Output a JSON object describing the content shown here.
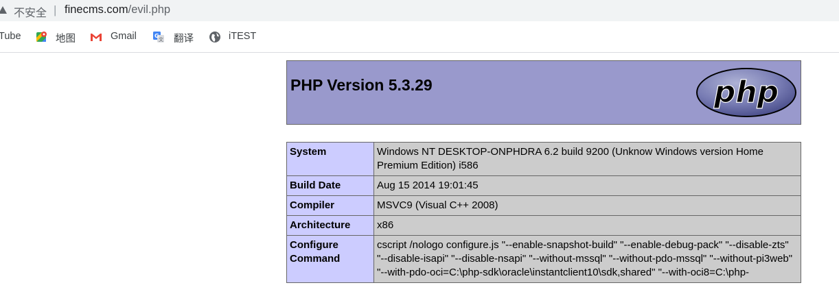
{
  "browser": {
    "security_label": "不安全",
    "separator": "|",
    "url_host": "finecms.com",
    "url_path": "/evil.php"
  },
  "bookmarks": [
    {
      "label": "Tube",
      "icon": "youtube-icon"
    },
    {
      "label": "地图",
      "icon": "maps-icon"
    },
    {
      "label": "Gmail",
      "icon": "gmail-icon"
    },
    {
      "label": "翻译",
      "icon": "translate-icon"
    },
    {
      "label": "iTEST",
      "icon": "globe-icon"
    }
  ],
  "phpinfo": {
    "title": "PHP Version 5.3.29",
    "logo_text": "php",
    "rows": [
      {
        "key": "System",
        "value": "Windows NT DESKTOP-ONPHDRA 6.2 build 9200 (Unknow Windows version Home Premium Edition) i586"
      },
      {
        "key": "Build Date",
        "value": "Aug 15 2014 19:01:45"
      },
      {
        "key": "Compiler",
        "value": "MSVC9 (Visual C++ 2008)"
      },
      {
        "key": "Architecture",
        "value": "x86"
      },
      {
        "key": "Configure Command",
        "value": "cscript /nologo configure.js \"--enable-snapshot-build\" \"--enable-debug-pack\" \"--disable-zts\" \"--disable-isapi\" \"--disable-nsapi\" \"--without-mssql\" \"--without-pdo-mssql\" \"--without-pi3web\" \"--with-pdo-oci=C:\\php-sdk\\oracle\\instantclient10\\sdk,shared\" \"--with-oci8=C:\\php-"
      }
    ]
  },
  "colors": {
    "header_bg": "#9999cc",
    "key_bg": "#ccccff",
    "value_bg": "#cccccc"
  }
}
